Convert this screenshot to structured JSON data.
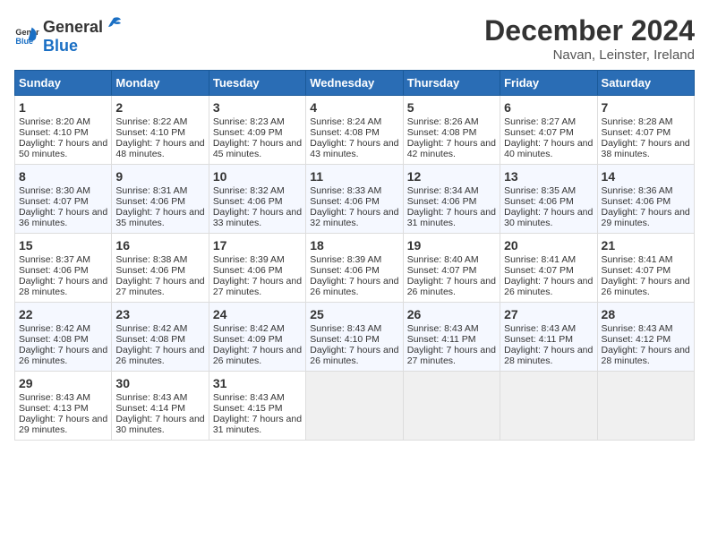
{
  "header": {
    "logo_general": "General",
    "logo_blue": "Blue",
    "title": "December 2024",
    "subtitle": "Navan, Leinster, Ireland"
  },
  "days_of_week": [
    "Sunday",
    "Monday",
    "Tuesday",
    "Wednesday",
    "Thursday",
    "Friday",
    "Saturday"
  ],
  "weeks": [
    [
      {
        "day": "1",
        "sunrise": "Sunrise: 8:20 AM",
        "sunset": "Sunset: 4:10 PM",
        "daylight": "Daylight: 7 hours and 50 minutes."
      },
      {
        "day": "2",
        "sunrise": "Sunrise: 8:22 AM",
        "sunset": "Sunset: 4:10 PM",
        "daylight": "Daylight: 7 hours and 48 minutes."
      },
      {
        "day": "3",
        "sunrise": "Sunrise: 8:23 AM",
        "sunset": "Sunset: 4:09 PM",
        "daylight": "Daylight: 7 hours and 45 minutes."
      },
      {
        "day": "4",
        "sunrise": "Sunrise: 8:24 AM",
        "sunset": "Sunset: 4:08 PM",
        "daylight": "Daylight: 7 hours and 43 minutes."
      },
      {
        "day": "5",
        "sunrise": "Sunrise: 8:26 AM",
        "sunset": "Sunset: 4:08 PM",
        "daylight": "Daylight: 7 hours and 42 minutes."
      },
      {
        "day": "6",
        "sunrise": "Sunrise: 8:27 AM",
        "sunset": "Sunset: 4:07 PM",
        "daylight": "Daylight: 7 hours and 40 minutes."
      },
      {
        "day": "7",
        "sunrise": "Sunrise: 8:28 AM",
        "sunset": "Sunset: 4:07 PM",
        "daylight": "Daylight: 7 hours and 38 minutes."
      }
    ],
    [
      {
        "day": "8",
        "sunrise": "Sunrise: 8:30 AM",
        "sunset": "Sunset: 4:07 PM",
        "daylight": "Daylight: 7 hours and 36 minutes."
      },
      {
        "day": "9",
        "sunrise": "Sunrise: 8:31 AM",
        "sunset": "Sunset: 4:06 PM",
        "daylight": "Daylight: 7 hours and 35 minutes."
      },
      {
        "day": "10",
        "sunrise": "Sunrise: 8:32 AM",
        "sunset": "Sunset: 4:06 PM",
        "daylight": "Daylight: 7 hours and 33 minutes."
      },
      {
        "day": "11",
        "sunrise": "Sunrise: 8:33 AM",
        "sunset": "Sunset: 4:06 PM",
        "daylight": "Daylight: 7 hours and 32 minutes."
      },
      {
        "day": "12",
        "sunrise": "Sunrise: 8:34 AM",
        "sunset": "Sunset: 4:06 PM",
        "daylight": "Daylight: 7 hours and 31 minutes."
      },
      {
        "day": "13",
        "sunrise": "Sunrise: 8:35 AM",
        "sunset": "Sunset: 4:06 PM",
        "daylight": "Daylight: 7 hours and 30 minutes."
      },
      {
        "day": "14",
        "sunrise": "Sunrise: 8:36 AM",
        "sunset": "Sunset: 4:06 PM",
        "daylight": "Daylight: 7 hours and 29 minutes."
      }
    ],
    [
      {
        "day": "15",
        "sunrise": "Sunrise: 8:37 AM",
        "sunset": "Sunset: 4:06 PM",
        "daylight": "Daylight: 7 hours and 28 minutes."
      },
      {
        "day": "16",
        "sunrise": "Sunrise: 8:38 AM",
        "sunset": "Sunset: 4:06 PM",
        "daylight": "Daylight: 7 hours and 27 minutes."
      },
      {
        "day": "17",
        "sunrise": "Sunrise: 8:39 AM",
        "sunset": "Sunset: 4:06 PM",
        "daylight": "Daylight: 7 hours and 27 minutes."
      },
      {
        "day": "18",
        "sunrise": "Sunrise: 8:39 AM",
        "sunset": "Sunset: 4:06 PM",
        "daylight": "Daylight: 7 hours and 26 minutes."
      },
      {
        "day": "19",
        "sunrise": "Sunrise: 8:40 AM",
        "sunset": "Sunset: 4:07 PM",
        "daylight": "Daylight: 7 hours and 26 minutes."
      },
      {
        "day": "20",
        "sunrise": "Sunrise: 8:41 AM",
        "sunset": "Sunset: 4:07 PM",
        "daylight": "Daylight: 7 hours and 26 minutes."
      },
      {
        "day": "21",
        "sunrise": "Sunrise: 8:41 AM",
        "sunset": "Sunset: 4:07 PM",
        "daylight": "Daylight: 7 hours and 26 minutes."
      }
    ],
    [
      {
        "day": "22",
        "sunrise": "Sunrise: 8:42 AM",
        "sunset": "Sunset: 4:08 PM",
        "daylight": "Daylight: 7 hours and 26 minutes."
      },
      {
        "day": "23",
        "sunrise": "Sunrise: 8:42 AM",
        "sunset": "Sunset: 4:08 PM",
        "daylight": "Daylight: 7 hours and 26 minutes."
      },
      {
        "day": "24",
        "sunrise": "Sunrise: 8:42 AM",
        "sunset": "Sunset: 4:09 PM",
        "daylight": "Daylight: 7 hours and 26 minutes."
      },
      {
        "day": "25",
        "sunrise": "Sunrise: 8:43 AM",
        "sunset": "Sunset: 4:10 PM",
        "daylight": "Daylight: 7 hours and 26 minutes."
      },
      {
        "day": "26",
        "sunrise": "Sunrise: 8:43 AM",
        "sunset": "Sunset: 4:11 PM",
        "daylight": "Daylight: 7 hours and 27 minutes."
      },
      {
        "day": "27",
        "sunrise": "Sunrise: 8:43 AM",
        "sunset": "Sunset: 4:11 PM",
        "daylight": "Daylight: 7 hours and 28 minutes."
      },
      {
        "day": "28",
        "sunrise": "Sunrise: 8:43 AM",
        "sunset": "Sunset: 4:12 PM",
        "daylight": "Daylight: 7 hours and 28 minutes."
      }
    ],
    [
      {
        "day": "29",
        "sunrise": "Sunrise: 8:43 AM",
        "sunset": "Sunset: 4:13 PM",
        "daylight": "Daylight: 7 hours and 29 minutes."
      },
      {
        "day": "30",
        "sunrise": "Sunrise: 8:43 AM",
        "sunset": "Sunset: 4:14 PM",
        "daylight": "Daylight: 7 hours and 30 minutes."
      },
      {
        "day": "31",
        "sunrise": "Sunrise: 8:43 AM",
        "sunset": "Sunset: 4:15 PM",
        "daylight": "Daylight: 7 hours and 31 minutes."
      },
      null,
      null,
      null,
      null
    ]
  ]
}
